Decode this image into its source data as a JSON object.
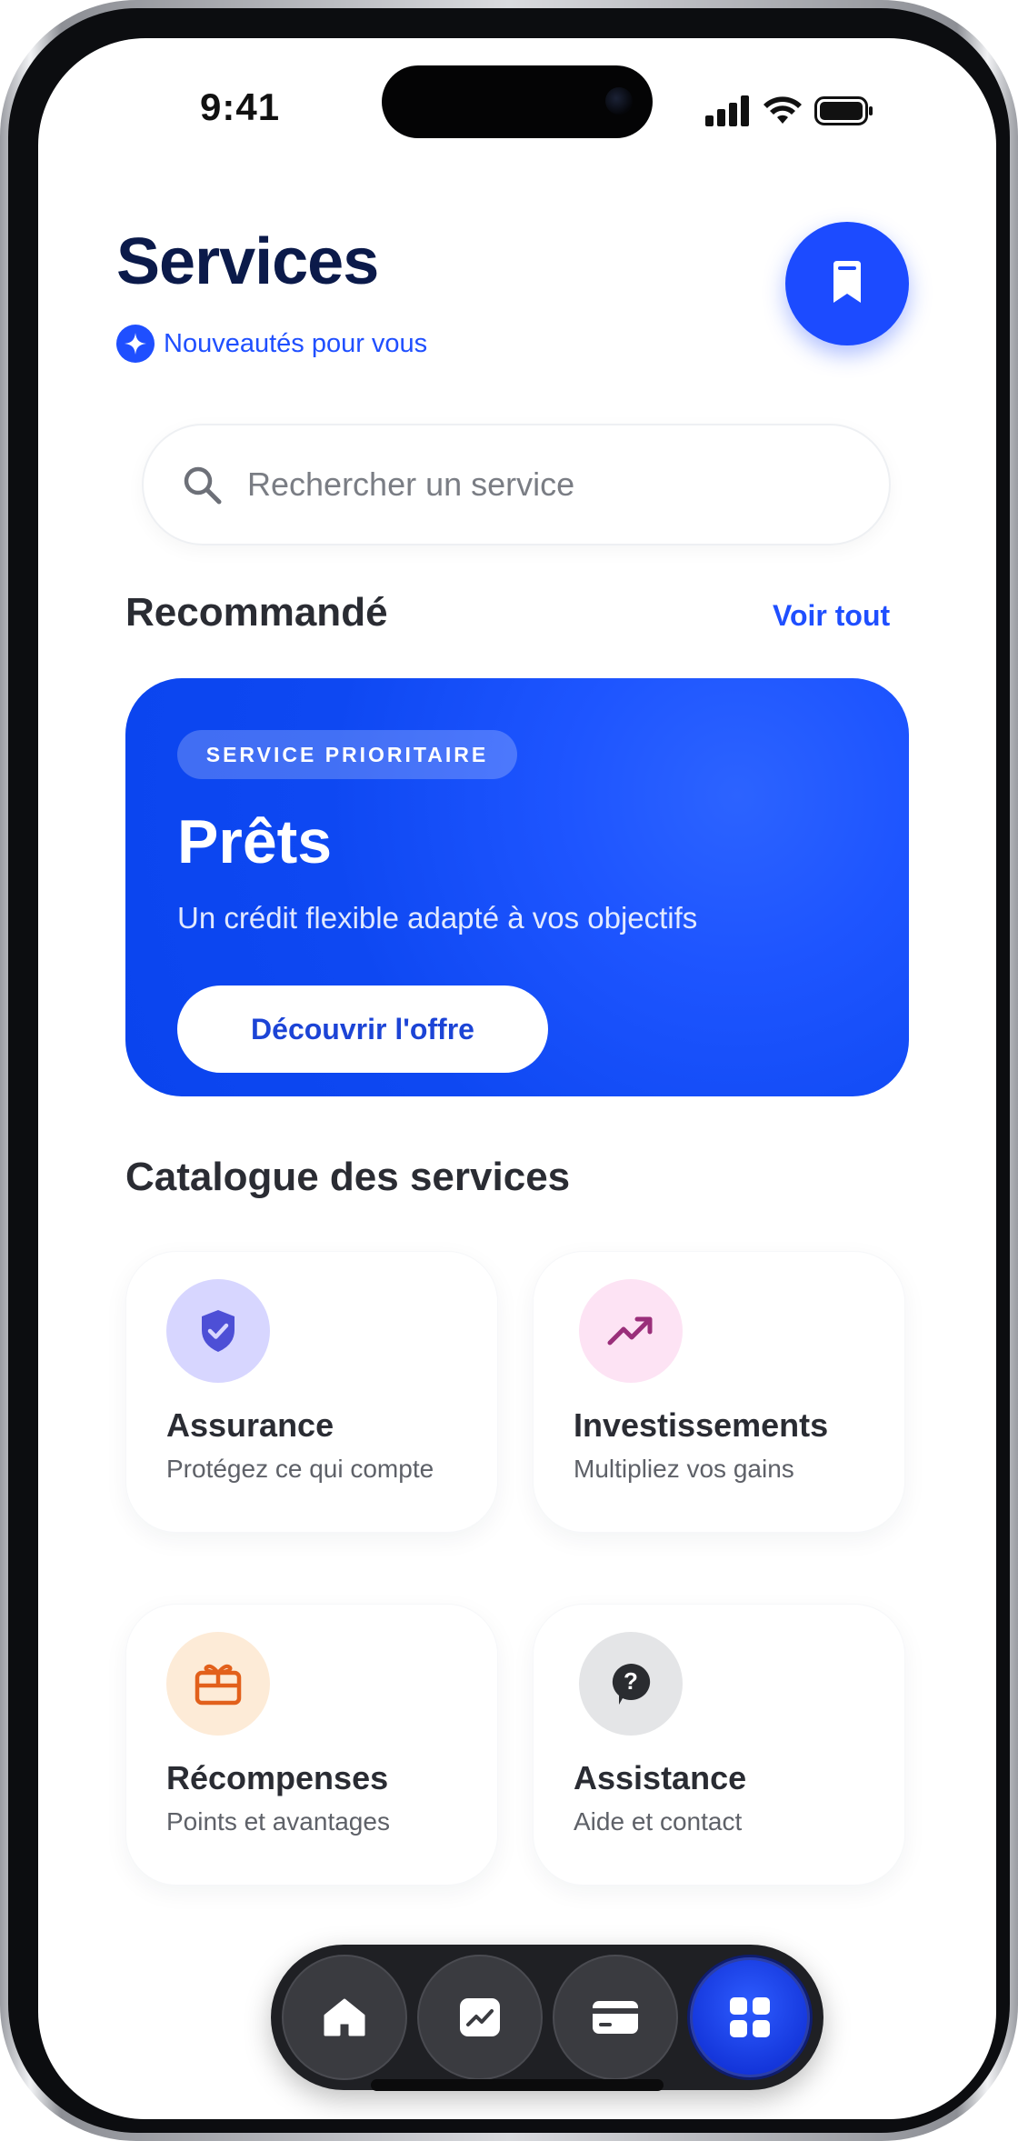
{
  "status_bar": {
    "time": "9:41"
  },
  "header": {
    "title": "Services",
    "subtitle": "Nouveautés pour vous",
    "bookmark_icon": "bookmark-icon"
  },
  "search": {
    "placeholder": "Rechercher un service",
    "icon": "search-icon"
  },
  "recommended": {
    "title": "Recommandé",
    "see_all": "Voir tout",
    "promo": {
      "badge": "SERVICE PRIORITAIRE",
      "title": "Prêts",
      "description": "Un crédit flexible adapté à vos objectifs",
      "cta": "Découvrir l'offre"
    }
  },
  "catalog": {
    "title": "Catalogue des services",
    "items": [
      {
        "name": "Assurance",
        "description": "Protégez ce qui compte",
        "icon": "shield-check-icon",
        "icon_bg": "#d7d6ff",
        "icon_color": "#4d4fd6"
      },
      {
        "name": "Investissements",
        "description": "Multipliez vos gains",
        "icon": "trending-up-icon",
        "icon_bg": "#fde3f4",
        "icon_color": "#9a2f7a"
      },
      {
        "name": "Récompenses",
        "description": "Points et avantages",
        "icon": "gift-icon",
        "icon_bg": "#fdebd7",
        "icon_color": "#e2601b"
      },
      {
        "name": "Assistance",
        "description": "Aide et contact",
        "icon": "help-bubble-icon",
        "icon_bg": "#e4e5e7",
        "icon_color": "#2a2c30"
      }
    ]
  },
  "tab_bar": {
    "tabs": [
      {
        "icon": "home-icon",
        "active": false
      },
      {
        "icon": "chart-icon",
        "active": false
      },
      {
        "icon": "card-icon",
        "active": false
      },
      {
        "icon": "grid-icon",
        "active": true
      }
    ]
  },
  "colors": {
    "accent": "#1f4fff",
    "title": "#0b1a4a",
    "text": "#2a2c33"
  }
}
